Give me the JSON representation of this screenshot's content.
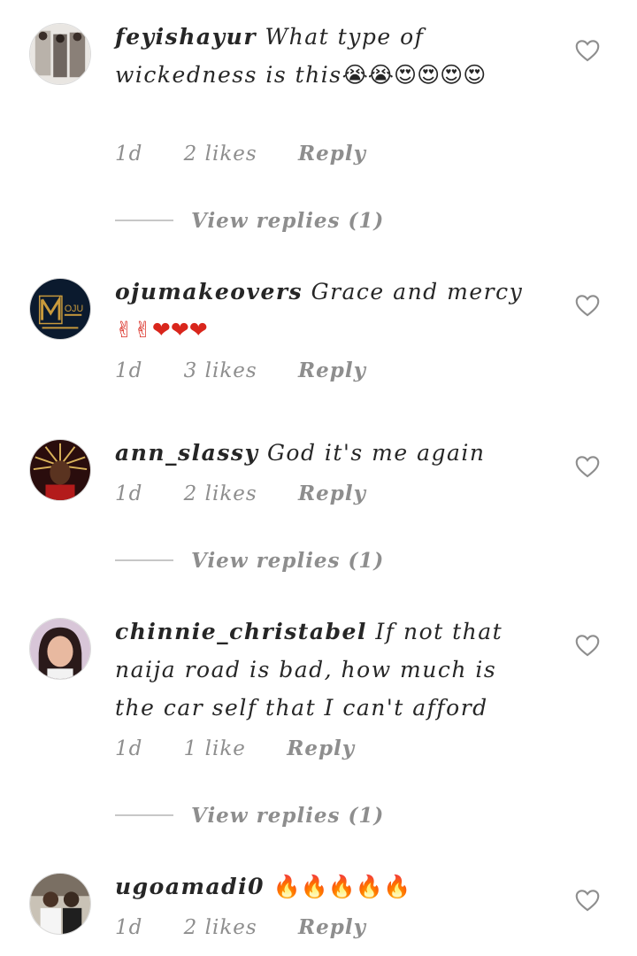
{
  "comments": [
    {
      "username": "feyishayur",
      "text": "What type of wickedness is this",
      "emoji": "😭😭😍😍😍😍",
      "time": "1d",
      "likes": "2 likes",
      "reply": "Reply",
      "view_replies": "View replies (1)"
    },
    {
      "username": "ojumakeovers",
      "text": "Grace and mercy",
      "emoji": "✌✌❤❤❤",
      "time": "1d",
      "likes": "3 likes",
      "reply": "Reply"
    },
    {
      "username": "ann_slassy",
      "text": "God it's me again",
      "emoji": "",
      "time": "1d",
      "likes": "2 likes",
      "reply": "Reply",
      "view_replies": "View replies (1)"
    },
    {
      "username": "chinnie_christabel",
      "text": "If not that naija road is bad, how much is the car self that I can't afford",
      "emoji": "",
      "time": "1d",
      "likes": "1 like",
      "reply": "Reply",
      "view_replies": "View replies (1)"
    },
    {
      "username": "ugoamadi0",
      "text": "",
      "emoji": "🔥🔥🔥🔥🔥",
      "time": "1d",
      "likes": "2 likes",
      "reply": "Reply"
    }
  ]
}
